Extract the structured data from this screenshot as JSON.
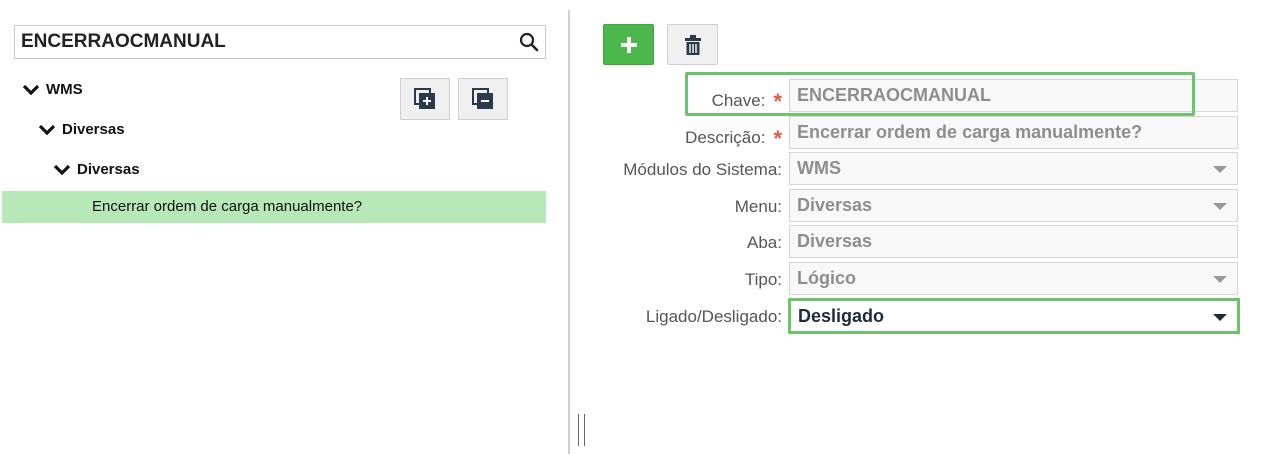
{
  "search": {
    "value": "ENCERRAOCMANUAL"
  },
  "tree": {
    "root": {
      "label": "WMS"
    },
    "level1": {
      "label": "Diversas"
    },
    "level2": {
      "label": "Diversas"
    },
    "leaf": {
      "label": "Encerrar ordem de carga manualmente?"
    }
  },
  "form": {
    "chave": {
      "label": "Chave:",
      "value": "ENCERRAOCMANUAL",
      "required_mark": "*"
    },
    "descricao": {
      "label": "Descrição:",
      "value": "Encerrar ordem de carga manualmente?",
      "required_mark": "*"
    },
    "modulos": {
      "label": "Módulos do Sistema:",
      "value": "WMS"
    },
    "menu": {
      "label": "Menu:",
      "value": "Diversas"
    },
    "aba": {
      "label": "Aba:",
      "value": "Diversas"
    },
    "tipo": {
      "label": "Tipo:",
      "value": "Lógico"
    },
    "ligado": {
      "label": "Ligado/Desligado:",
      "value": "Desligado"
    }
  },
  "colors": {
    "selected_row": "#b7e8b7",
    "add_button": "#4cb84c",
    "highlight_border": "#6cc36c",
    "required": "#e05a45"
  }
}
